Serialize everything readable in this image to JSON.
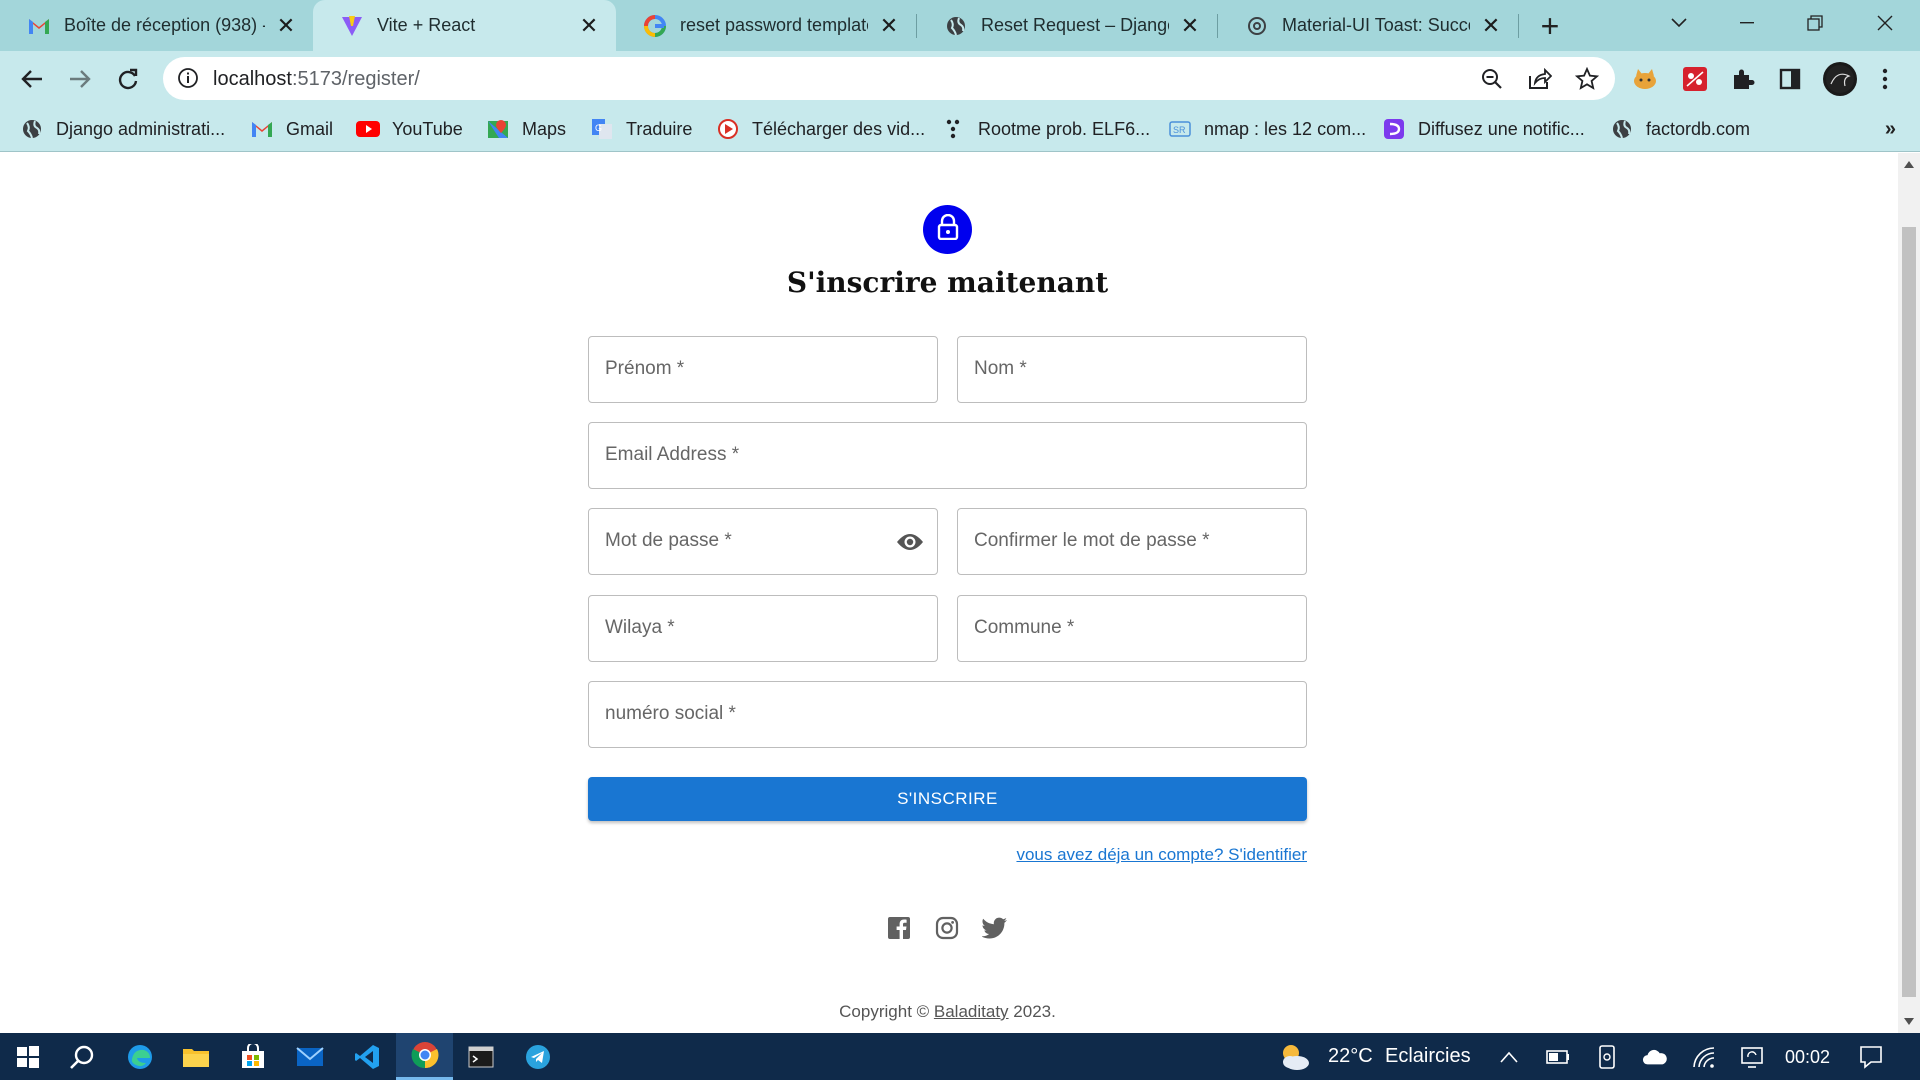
{
  "browser": {
    "tabs": [
      {
        "title": "Boîte de réception (938) -",
        "icon": "gmail-icon",
        "active": false
      },
      {
        "title": "Vite + React",
        "icon": "vite-icon",
        "active": true
      },
      {
        "title": "reset password template",
        "icon": "google-icon",
        "active": false
      },
      {
        "title": "Reset Request – Django R",
        "icon": "globe-icon",
        "active": false
      },
      {
        "title": "Material-UI Toast: Succes",
        "icon": "openai-icon",
        "active": false
      }
    ],
    "new_tab": "+",
    "url_host": "localhost",
    "url_rest": ":5173/register/",
    "bookmarks": [
      {
        "label": "Django administrati...",
        "icon": "globe-icon"
      },
      {
        "label": "Gmail",
        "icon": "gmail-icon"
      },
      {
        "label": "YouTube",
        "icon": "youtube-icon"
      },
      {
        "label": "Maps",
        "icon": "maps-icon"
      },
      {
        "label": "Traduire",
        "icon": "translate-icon"
      },
      {
        "label": "Télécharger des vid...",
        "icon": "download-video-icon"
      },
      {
        "label": "Rootme prob. ELF6...",
        "icon": "rootme-icon"
      },
      {
        "label": "nmap : les 12 com...",
        "icon": "nmap-icon"
      },
      {
        "label": "Diffusez une notific...",
        "icon": "notification-icon"
      },
      {
        "label": "factordb.com",
        "icon": "globe-icon"
      }
    ],
    "bookmarks_more": "»"
  },
  "form": {
    "heading": "S'inscrire maitenant",
    "fields": {
      "prenom": "Prénom *",
      "nom": "Nom *",
      "email": "Email Address *",
      "password": "Mot de passe *",
      "confirm": "Confirmer le mot de passe *",
      "wilaya": "Wilaya *",
      "commune": "Commune *",
      "social": "numéro social *"
    },
    "submit": "S'INSCRIRE",
    "login_link": "vous avez déja un compte? S'identifier"
  },
  "social_icons": [
    "facebook-icon",
    "instagram-icon",
    "twitter-icon"
  ],
  "footer": {
    "prefix": "Copyright © ",
    "brand": "Baladitaty",
    "suffix": " 2023."
  },
  "taskbar": {
    "weather_temp": "22°C",
    "weather_text": "Eclaircies",
    "time": "00:02"
  },
  "colors": {
    "tab_strip": "#a3d6da",
    "toolbar": "#c7e9ec",
    "avatar": "#0000ee",
    "primary": "#1976d2",
    "taskbar": "#0f2a4a"
  }
}
